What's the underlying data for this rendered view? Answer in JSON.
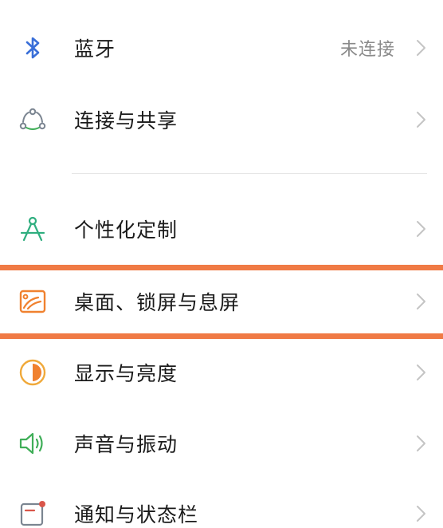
{
  "settings": {
    "items": [
      {
        "name": "bluetooth",
        "label": "蓝牙",
        "value": "未连接",
        "icon": "bluetooth-icon"
      },
      {
        "name": "connect-share",
        "label": "连接与共享",
        "icon": "connection-share-icon"
      },
      {
        "name": "personalization",
        "label": "个性化定制",
        "icon": "compass-icon"
      },
      {
        "name": "desktop-lockscreen",
        "label": "桌面、锁屏与息屏",
        "icon": "wallpaper-icon"
      },
      {
        "name": "display-brightness",
        "label": "显示与亮度",
        "icon": "brightness-icon"
      },
      {
        "name": "sound-vibration",
        "label": "声音与振动",
        "icon": "speaker-icon"
      },
      {
        "name": "notification-statusbar",
        "label": "通知与状态栏",
        "icon": "notification-icon"
      }
    ]
  },
  "colors": {
    "highlight": "#f07a45",
    "bluetooth": "#3a6fd8",
    "connect": "#7b8591",
    "personalization": "#2fae7f",
    "desktop": "#f0812f",
    "display": "#f0a93a",
    "sound": "#3fae58",
    "notification": "#d9564a"
  }
}
